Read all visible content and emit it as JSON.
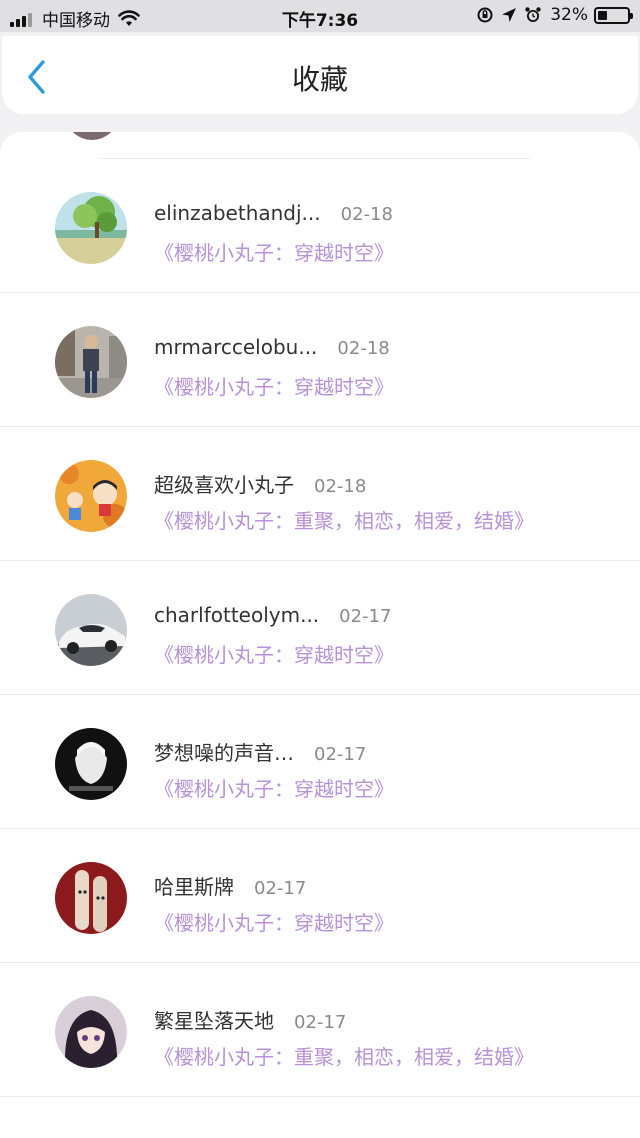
{
  "status_bar": {
    "carrier": "中国移动",
    "time": "下午7:36",
    "battery": "32%",
    "battery_level": 0.32
  },
  "header": {
    "title": "收藏"
  },
  "items": [
    {
      "name": "elinzabethandj...",
      "date": "02-18",
      "title": "《樱桃小丸子：穿越时空》",
      "avatar": "landscape-tree"
    },
    {
      "name": "mrmarccelobu...",
      "date": "02-18",
      "title": "《樱桃小丸子：穿越时空》",
      "avatar": "man-street"
    },
    {
      "name": "超级喜欢小丸子",
      "date": "02-18",
      "title": "《樱桃小丸子：重聚，相恋，相爱，结婚》",
      "avatar": "cartoon-autumn"
    },
    {
      "name": "charlfotteolym...",
      "date": "02-17",
      "title": "《樱桃小丸子：穿越时空》",
      "avatar": "white-car"
    },
    {
      "name": "梦想噪的声音…",
      "date": "02-17",
      "title": "《樱桃小丸子：穿越时空》",
      "avatar": "dark-portrait"
    },
    {
      "name": "哈里斯牌",
      "date": "02-17",
      "title": "《樱桃小丸子：穿越时空》",
      "avatar": "finger-faces"
    },
    {
      "name": "繁星坠落天地",
      "date": "02-17",
      "title": "《樱桃小丸子：重聚，相恋，相爱，结婚》",
      "avatar": "anime-girl"
    }
  ],
  "colors": {
    "accent": "#2a9bd8",
    "title_purple": "#b792d6",
    "background": "#f1f1f3"
  }
}
